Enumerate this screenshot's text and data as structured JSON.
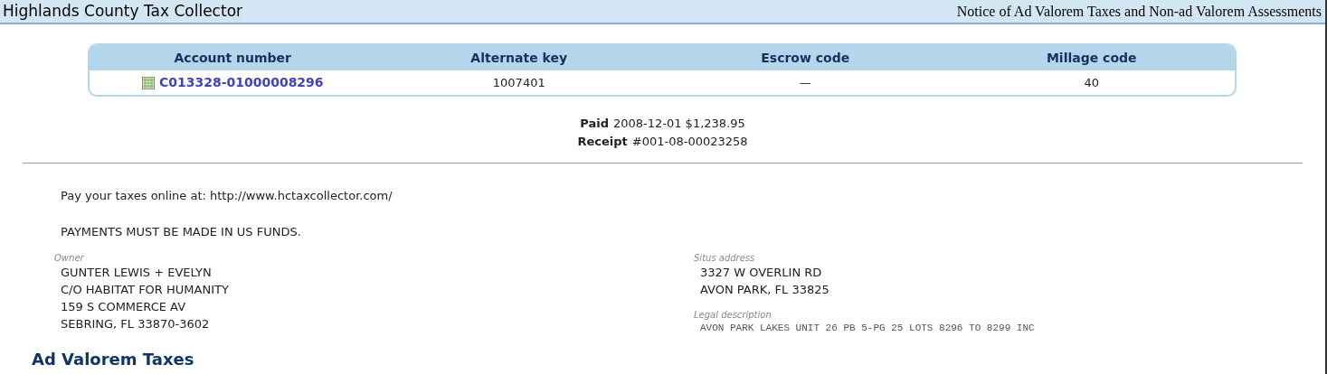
{
  "header": {
    "title": "Highlands County Tax Collector",
    "notice": "Notice of Ad Valorem Taxes and Non-ad Valorem Assessments"
  },
  "account_table": {
    "columns": [
      "Account number",
      "Alternate key",
      "Escrow code",
      "Millage code"
    ],
    "row": {
      "account_number": "C013328-01000008296",
      "alternate_key": "1007401",
      "escrow_code": "—",
      "millage_code": "40"
    }
  },
  "payment": [
    {
      "label": "Paid",
      "value": "2008-12-01 $1,238.95"
    },
    {
      "label": "Receipt",
      "value": "#001-08-00023258"
    }
  ],
  "notices": [
    "Pay your taxes online at: http://www.hctaxcollector.com/",
    "PAYMENTS MUST BE MADE IN US FUNDS."
  ],
  "owner": {
    "label": "Owner",
    "lines": [
      "GUNTER LEWIS + EVELYN",
      "C/O HABITAT FOR HUMANITY",
      "159 S COMMERCE AV",
      "SEBRING, FL 33870-3602"
    ]
  },
  "situs": {
    "label": "Situs address",
    "lines": [
      "3327 W OVERLIN RD",
      "AVON PARK, FL 33825"
    ]
  },
  "legal": {
    "label": "Legal description",
    "text": "AVON PARK LAKES UNIT 26 PB 5-PG 25 LOTS 8296 TO 8299 INC"
  },
  "section_title": "Ad Valorem Taxes"
}
